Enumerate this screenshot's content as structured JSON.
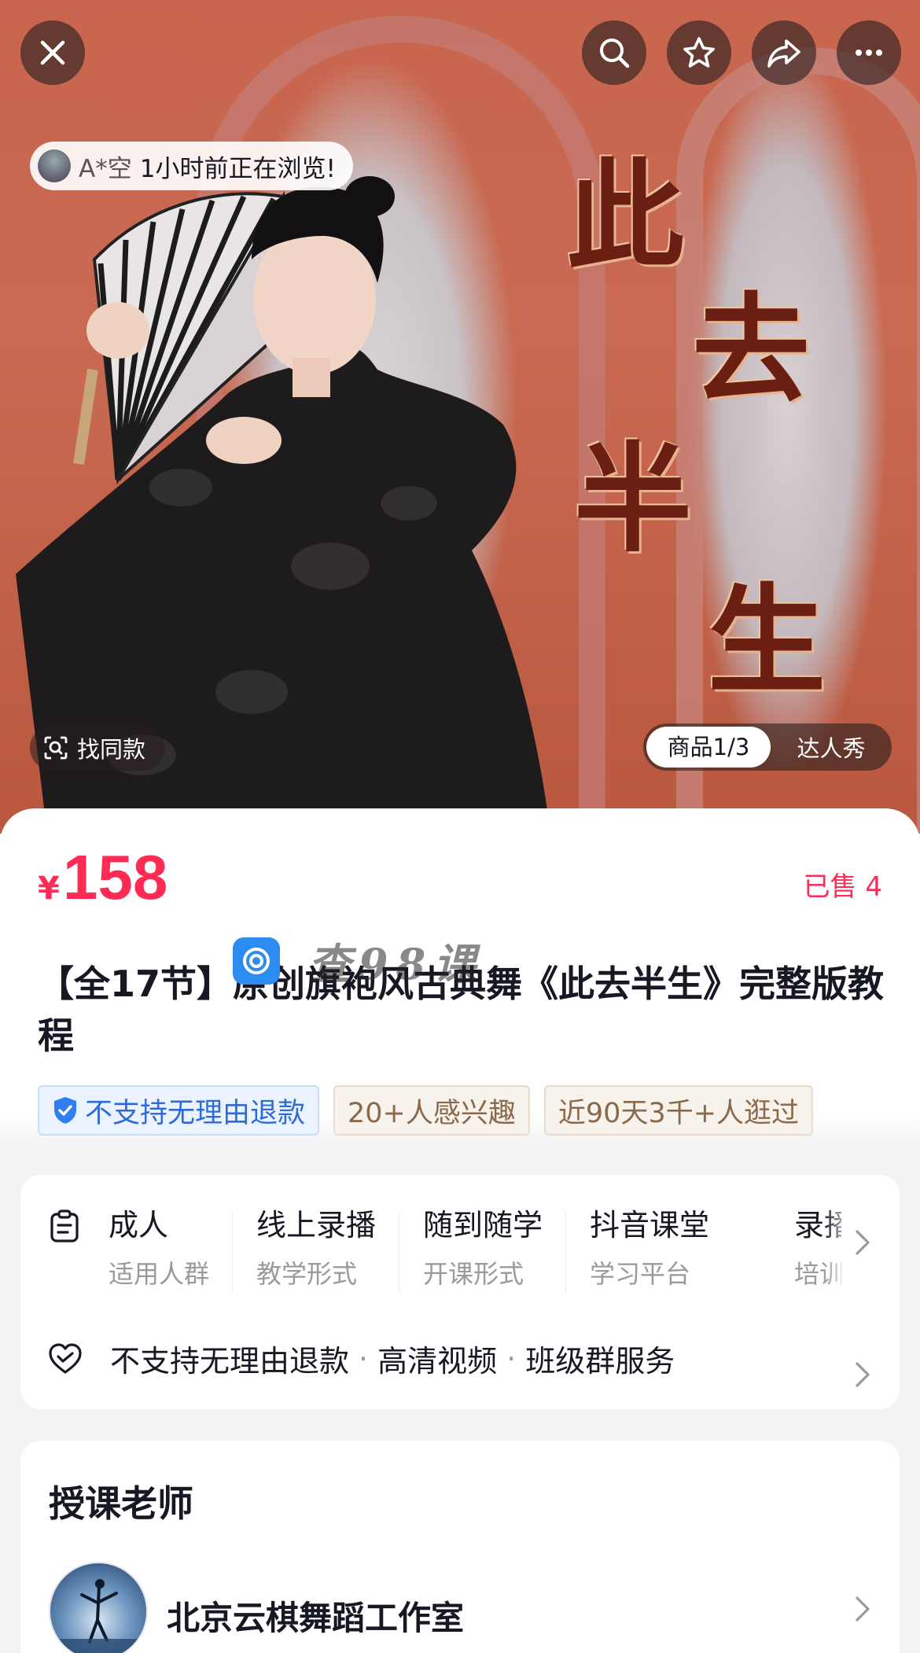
{
  "hero": {
    "viewer_user": "A*空",
    "viewer_text": "1小时前正在浏览!",
    "title_chars": [
      "此",
      "去",
      "半",
      "生"
    ],
    "find_same_label": "找同款",
    "media_tabs": [
      "商品1/3",
      "达人秀"
    ],
    "active_media_tab": 0
  },
  "product": {
    "currency": "¥",
    "price": "158",
    "sold": "已售 4",
    "watermark_text": "查98课",
    "title": "【全17节】原创旗袍风古典舞《此去半生》完整版教程",
    "tags": [
      {
        "label": "不支持无理由退款",
        "style": "blue",
        "icon": "shield-check-icon"
      },
      {
        "label": "20+人感兴趣",
        "style": "beige"
      },
      {
        "label": "近90天3千+人逛过",
        "style": "beige"
      }
    ]
  },
  "specs": {
    "items": [
      {
        "value": "成人",
        "key": "适用人群"
      },
      {
        "value": "线上录播",
        "key": "教学形式"
      },
      {
        "value": "随到随学",
        "key": "开课形式"
      },
      {
        "value": "抖音课堂",
        "key": "学习平台"
      },
      {
        "value": "录播",
        "key": "培训"
      }
    ],
    "services": [
      "不支持无理由退款",
      "高清视频",
      "班级群服务"
    ],
    "separator": "·"
  },
  "teacher": {
    "section_title": "授课老师",
    "name": "北京云棋舞蹈工作室"
  },
  "colors": {
    "accent": "#fe2c55",
    "tag_blue": "#2f6ad9",
    "tag_beige": "#8a6a4a"
  }
}
